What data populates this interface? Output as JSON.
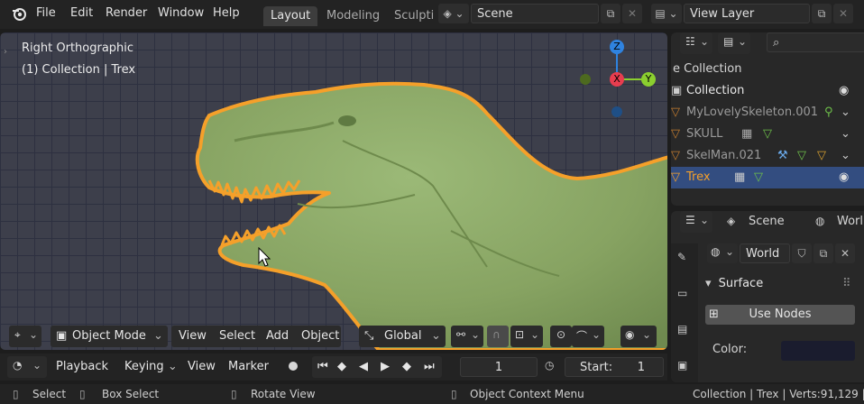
{
  "topbar": {
    "menus": [
      "File",
      "Edit",
      "Render",
      "Window",
      "Help"
    ],
    "workspaces": [
      "Layout",
      "Modeling",
      "Sculpti"
    ],
    "scene": "Scene",
    "view_layer": "View Layer"
  },
  "viewport": {
    "view_name": "Right Orthographic",
    "collection_info": "(1) Collection | Trex",
    "gizmo": {
      "z": "Z",
      "x": "X",
      "y": "Y"
    },
    "header": {
      "mode": "Object Mode",
      "menus": [
        "View",
        "Select",
        "Add",
        "Object"
      ],
      "orientation": "Global"
    }
  },
  "timeline": {
    "playback": "Playback",
    "keying": "Keying",
    "view": "View",
    "marker": "Marker",
    "current_frame": "1",
    "start_label": "Start:",
    "start_value": "1"
  },
  "outliner": {
    "header_row": "e Collection",
    "rows": [
      {
        "name": "Collection"
      },
      {
        "name": "MyLovelySkeleton.001"
      },
      {
        "name": "SKULL"
      },
      {
        "name": "SkelMan.021"
      },
      {
        "name": "Trex"
      }
    ]
  },
  "properties": {
    "scene": "Scene",
    "world_tab": "Worl",
    "world_field": "World",
    "surface_panel": "Surface",
    "use_nodes": "Use Nodes",
    "color_label": "Color:",
    "color_value": "#1a1c2e"
  },
  "statusbar": {
    "select": "Select",
    "box_select": "Box Select",
    "rotate_view": "Rotate View",
    "context_menu": "Object Context Menu",
    "stats": "Collection | Trex | Verts:91,129 | Fa"
  },
  "colors": {
    "selection_outline": "#f5a02a",
    "model": "#8aa866",
    "active_row": "#334d80",
    "axis_x": "#e83d4f",
    "axis_y": "#8bcf2f",
    "axis_z": "#2f83e0"
  }
}
